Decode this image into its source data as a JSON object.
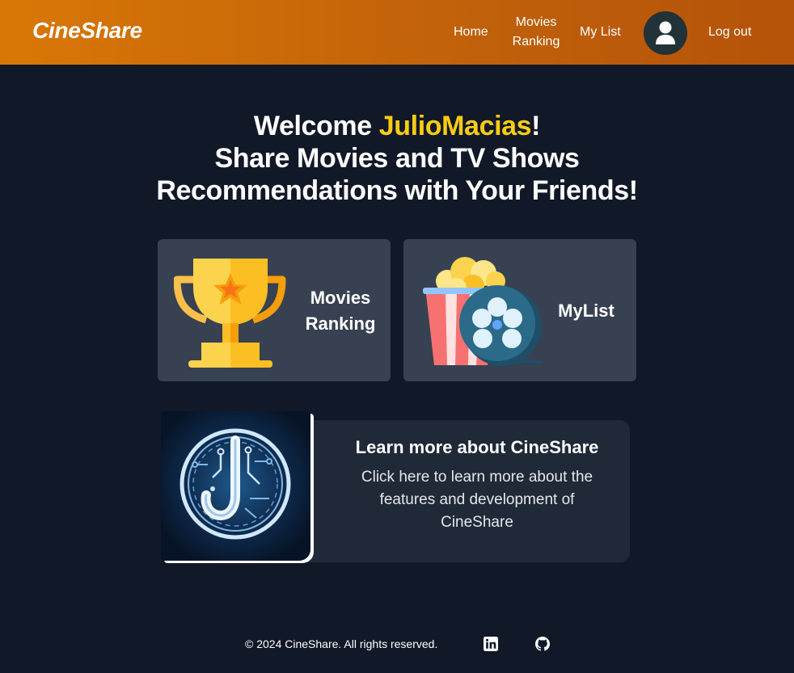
{
  "header": {
    "brand": "CineShare",
    "nav": {
      "home": "Home",
      "ranking_line1": "Movies",
      "ranking_line2": "Ranking",
      "mylist": "My List",
      "logout": "Log out"
    },
    "accent_color": "#d97706",
    "avatar_icon": "user-icon"
  },
  "hero": {
    "welcome": "Welcome",
    "username": "JulioMacias",
    "exclaim": "!",
    "line2": "Share Movies and TV Shows",
    "line3": "Recommendations with Your Friends!",
    "username_color": "#facc15"
  },
  "cards": {
    "ranking": {
      "title_line1": "Movies",
      "title_line2": "Ranking",
      "icon": "trophy-icon"
    },
    "mylist": {
      "title": "MyList",
      "icon": "popcorn-film-reel-icon"
    }
  },
  "learn_more": {
    "title": "Learn more about CineShare",
    "description": "Click here to learn more about the features and development of CineShare",
    "image": "circuit-j-logo"
  },
  "footer": {
    "copyright": "© 2024 CineShare. All rights reserved.",
    "icons": [
      "linkedin-icon",
      "github-icon"
    ]
  },
  "colors": {
    "background": "#111827",
    "card": "#374151",
    "learn_card": "#1f2937"
  }
}
